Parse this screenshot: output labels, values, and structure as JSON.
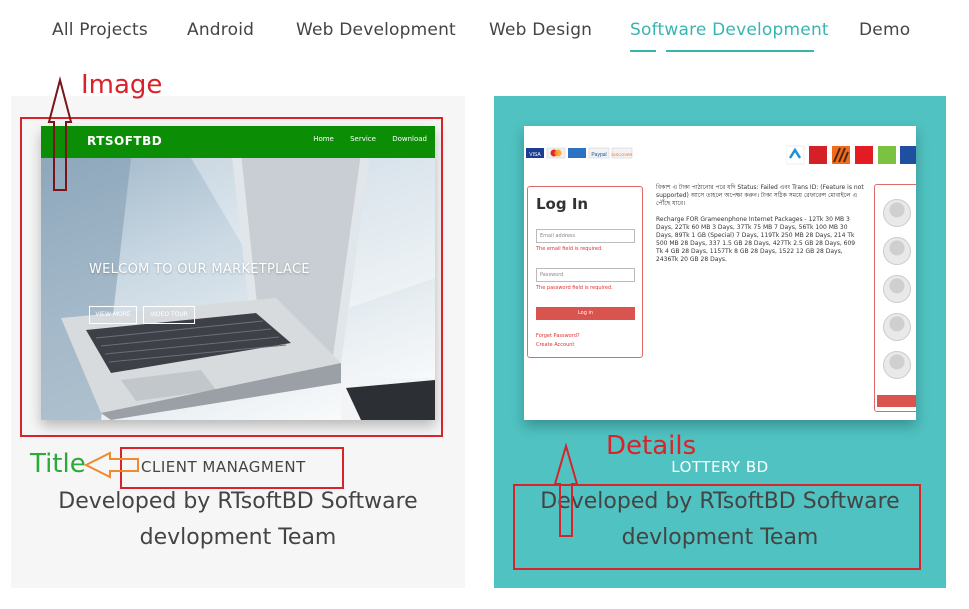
{
  "tabs": [
    {
      "label": "All Projects",
      "active": false
    },
    {
      "label": "Android",
      "active": false
    },
    {
      "label": "Web Development",
      "active": false
    },
    {
      "label": "Web Design",
      "active": false
    },
    {
      "label": "Software Development",
      "active": true
    },
    {
      "label": "Demo",
      "active": false
    }
  ],
  "accent_color": "#39b5b0",
  "cards": [
    {
      "title": "CLIENT MANAGMENT",
      "description_line1": "Developed by RTsoftBD Software",
      "description_line2": "devlopment Team",
      "background": "#f6f6f6",
      "screenshot": {
        "logo": "RTSOFTBD",
        "nav_links": [
          "Home",
          "Service",
          "Download"
        ],
        "hero_text": "WELCOM TO OUR MARKETPLACE",
        "buttons": [
          "VIEW MORE",
          "VIDEO TOUR"
        ]
      }
    },
    {
      "title": "LOTTERY BD",
      "description_line1": "Developed by RTsoftBD Software",
      "description_line2": "devlopment Team",
      "background": "#4fc2c1",
      "screenshot": {
        "payment_logos": [
          "VISA",
          "MasterCard",
          "AMEX",
          "Paypal",
          "DISCOVER"
        ],
        "operator_icons": [
          "grameenphone",
          "robi",
          "banglalink",
          "airtel",
          "teletalk",
          "citycell"
        ],
        "login_title": "Log In",
        "email_placeholder": "Email address",
        "email_error": "The email field is required.",
        "password_placeholder": "Password",
        "password_error": "The password field is required.",
        "login_button": "Log in",
        "forgot_link": "Forget Password?",
        "create_link": "Create Account",
        "notice_bn": "বিকাশ এ টাকা পাঠানোর পরে যদি Status: Failed এবং Trans ID: (Feature is not supported) আসে তাহলে অপেক্ষা করুন। টাকা সঠিক সময়ে রেফারেন্স মোবাইলে এ পৌঁছে যাবে।",
        "notice_packages": "Recharge FOR Grameenphone Internet Packages - 12Tk 30 MB 3 Days, 22Tk 60 MB 3 Days, 37Tk 75 MB 7 Days, 56Tk 100 MB 30 Days, 89Tk 1 GB (Special) 7 Days, 119Tk 250 MB 28 Days, 214 Tk 500 MB 28 Days, 337 1.5 GB 28 Days, 427Tk 2.5 GB 28 Days, 609 Tk 4 GB 28 Days, 1157Tk 8 GB 28 Days, 1522 12 GB 28 Days, 2436Tk 20 GB 28 Days."
      }
    }
  ],
  "annotations": {
    "image": {
      "label": "Image",
      "color": "#d8232a"
    },
    "title": {
      "label": "Title",
      "color": "#2aaa3a"
    },
    "details": {
      "label": "Details",
      "color": "#d8232a"
    }
  }
}
